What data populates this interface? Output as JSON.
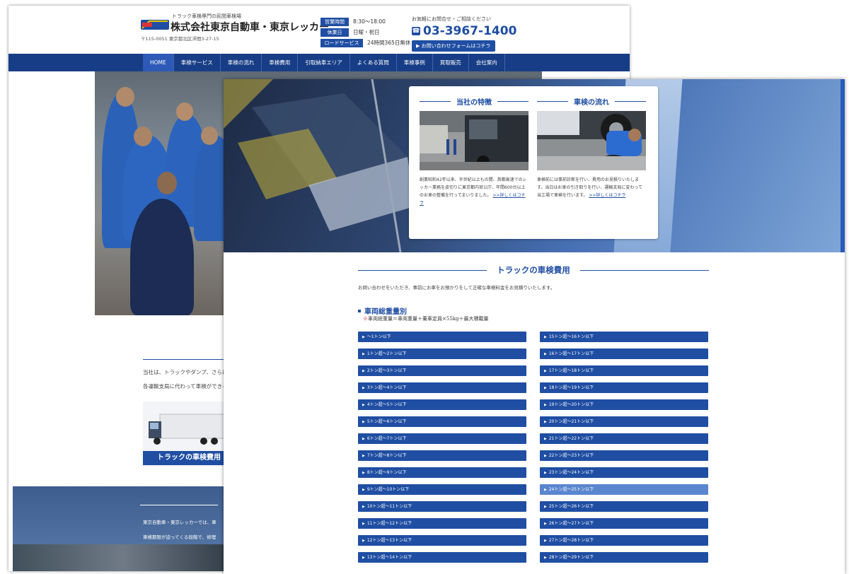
{
  "back": {
    "tagline": "トラック車検専門の民間車検場",
    "company": "株式会社東京自動車・東京レッカー",
    "address": "〒115-0051 東京都北区浮間3-27-15",
    "hours": [
      {
        "label": "営業時間",
        "value": "8:30〜18:00"
      },
      {
        "label": "休業日",
        "value": "日曜・祝日"
      },
      {
        "label": "ロードサービス",
        "value": "24時間365日無休"
      }
    ],
    "contact_caption": "お気軽にお問合せ・ご相談ください",
    "phone": "03-3967-1400",
    "form_button": "▶ お問い合わせフォームはコチラ",
    "nav": [
      "HOME",
      "車検サービス",
      "車検の流れ",
      "車検費用",
      "引取納車エリア",
      "よくある質問",
      "車検事例",
      "買取販売",
      "会社案内"
    ],
    "body_text_1": "当社は、トラックやダンプ、さらに",
    "body_text_2": "各運輸支局に代わって車検ができる",
    "truck_caption": "トラックの車検費用",
    "band_text_1": "東京自動車・東京レッカーでは、車",
    "band_text_2": "車検期限が迫ってくる段階で、修理"
  },
  "front": {
    "features": [
      {
        "title": "当社の特徴",
        "text": "創業昭和42年以来、半世紀以上もの間、首都高速でのレッカー業務を皮切りに東京都内官公庁、年間600台以上のお車の整備を行ってまいりました。",
        "link": ">>詳しくはコチラ"
      },
      {
        "title": "車検の流れ",
        "text": "車検前には事前診断を行い、費用のお見積りいたします。当日はお車の引き取りを行い、運輸支局に変わって当工場で車検を行います。",
        "link": ">>詳しくはコチラ"
      }
    ],
    "section_title": "トラックの車検費用",
    "section_lead": "お問い合わせをいただき、事前にお車をお預かりをして正確な車検料金をお見積りいたします。",
    "category_title": "車両総重量別",
    "category_note_mark": "※",
    "category_note": "車両総重量＝車両重量＋乗車定員×55kg＋最大積載量",
    "weights_left": [
      "〜1トン以下",
      "1トン超〜2トン以下",
      "2トン超〜3トン以下",
      "3トン超〜4トン以下",
      "4トン超〜5トン以下",
      "5トン超〜6トン以下",
      "6トン超〜7トン以下",
      "7トン超〜8トン以下",
      "8トン超〜9トン以下",
      "9トン超〜10トン以下",
      "10トン超〜11トン以下",
      "11トン超〜12トン以下",
      "12トン超〜13トン以下",
      "13トン超〜14トン以下"
    ],
    "weights_right": [
      "15トン超〜16トン以下",
      "16トン超〜17トン以下",
      "17トン超〜18トン以下",
      "18トン超〜19トン以下",
      "19トン超〜20トン以下",
      "20トン超〜21トン以下",
      "21トン超〜22トン以下",
      "22トン超〜23トン以下",
      "23トン超〜24トン以下",
      "24トン超〜25トン以下",
      "25トン超〜26トン以下",
      "26トン超〜27トン以下",
      "27トン超〜28トン以下",
      "28トン超〜29トン以下"
    ],
    "highlighted_right_index": 9
  },
  "colors": {
    "brand": "#1f4ea3",
    "nav": "#173d86",
    "hover": "#5a86cf"
  },
  "icons": [
    "logo",
    "phone-icon",
    "triangle-right-icon"
  ]
}
